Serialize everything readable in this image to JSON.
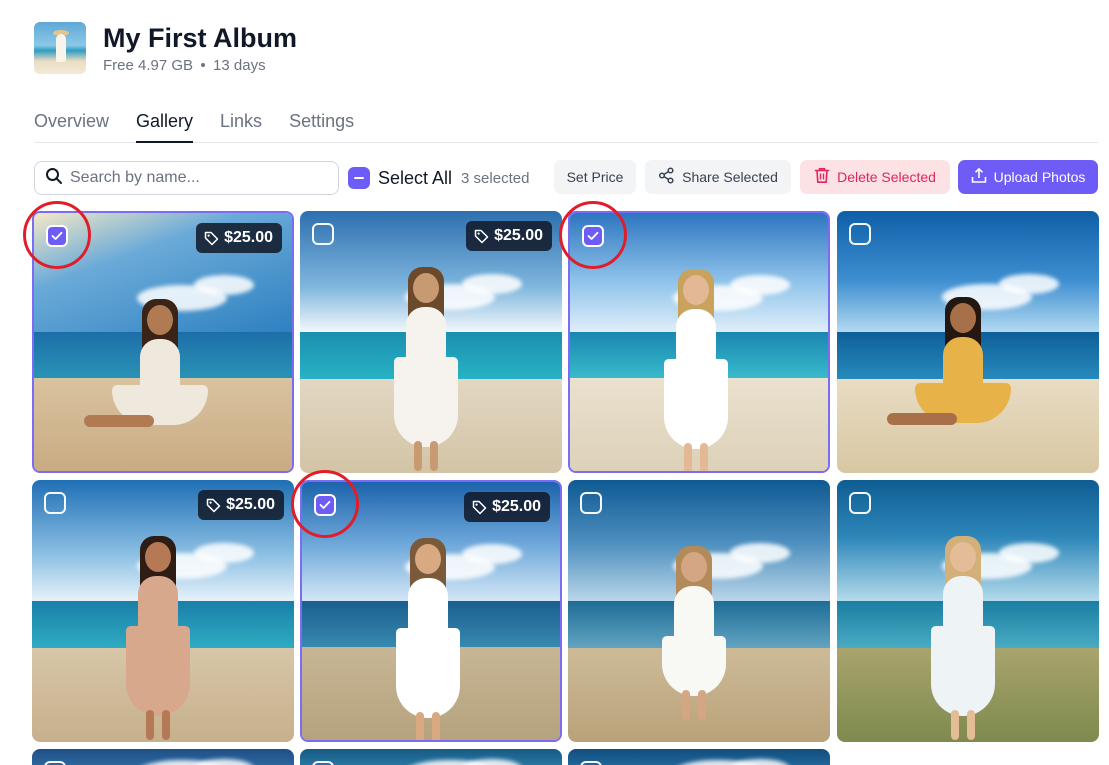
{
  "album": {
    "title": "My First Album",
    "storage": "Free 4.97 GB",
    "duration": "13 days"
  },
  "tabs": [
    {
      "label": "Overview",
      "active": false
    },
    {
      "label": "Gallery",
      "active": true
    },
    {
      "label": "Links",
      "active": false
    },
    {
      "label": "Settings",
      "active": false
    }
  ],
  "toolbar": {
    "search_placeholder": "Search by name...",
    "select_all_label": "Select All",
    "selected_count": "3 selected",
    "set_price_label": "Set Price",
    "share_label": "Share Selected",
    "delete_label": "Delete Selected",
    "upload_label": "Upload Photos"
  },
  "colors": {
    "accent": "#6d5cf6",
    "delete_bg": "#fde2e4",
    "delete_text": "#e0245e",
    "highlight_ring": "#e11d2a"
  },
  "photos": [
    {
      "selected": true,
      "price": "$25.00"
    },
    {
      "selected": false,
      "price": "$25.00"
    },
    {
      "selected": true,
      "price": ""
    },
    {
      "selected": false,
      "price": ""
    },
    {
      "selected": false,
      "price": "$25.00"
    },
    {
      "selected": true,
      "price": "$25.00"
    },
    {
      "selected": false,
      "price": ""
    },
    {
      "selected": false,
      "price": ""
    },
    {
      "selected": false,
      "price": ""
    },
    {
      "selected": false,
      "price": ""
    },
    {
      "selected": false,
      "price": ""
    }
  ],
  "icons": {
    "search": "search-icon",
    "share": "share-icon",
    "delete": "trash-icon",
    "upload": "upload-icon",
    "price_tag": "tag-icon",
    "check": "check-icon"
  }
}
